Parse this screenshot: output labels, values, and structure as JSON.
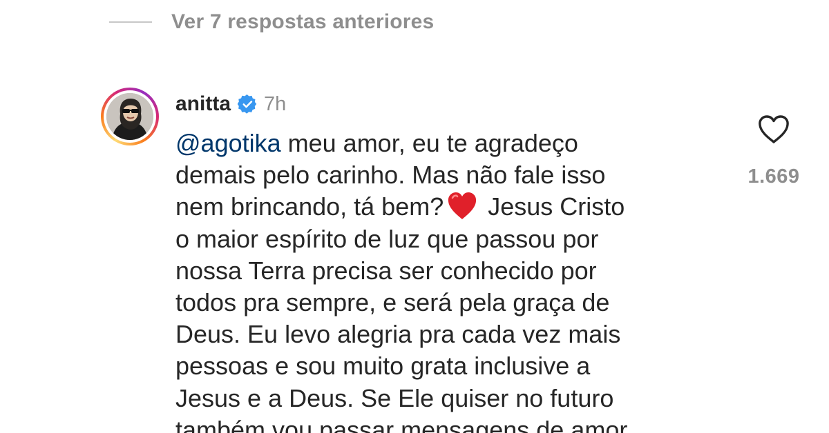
{
  "view_previous_replies": "Ver 7 respostas anteriores",
  "comment": {
    "username": "anitta",
    "verified": true,
    "time": "7h",
    "mention": "@agotika",
    "lines": [
      " meu amor, eu te agradeço",
      "demais pelo carinho. Mas não fale isso",
      "nem brincando, tá bem?",
      " Jesus Cristo",
      "o maior espírito de luz que passou por",
      "nossa Terra precisa ser conhecido por",
      "todos pra sempre, e será pela graça de",
      "Deus. Eu levo alegria pra cada vez mais",
      "pessoas e sou muito grata inclusive a",
      "Jesus e a Deus. Se Ele quiser no futuro",
      "também vou passar mensagens de amor"
    ],
    "emoji": "red-heart-emoji",
    "like_icon": "heart-outline-icon",
    "like_count": "1.669"
  },
  "colors": {
    "mention": "#00376b",
    "text": "#262626",
    "secondary": "#8e8e8e",
    "verified": "#3897f0",
    "heart_emoji": "#e0202a"
  }
}
